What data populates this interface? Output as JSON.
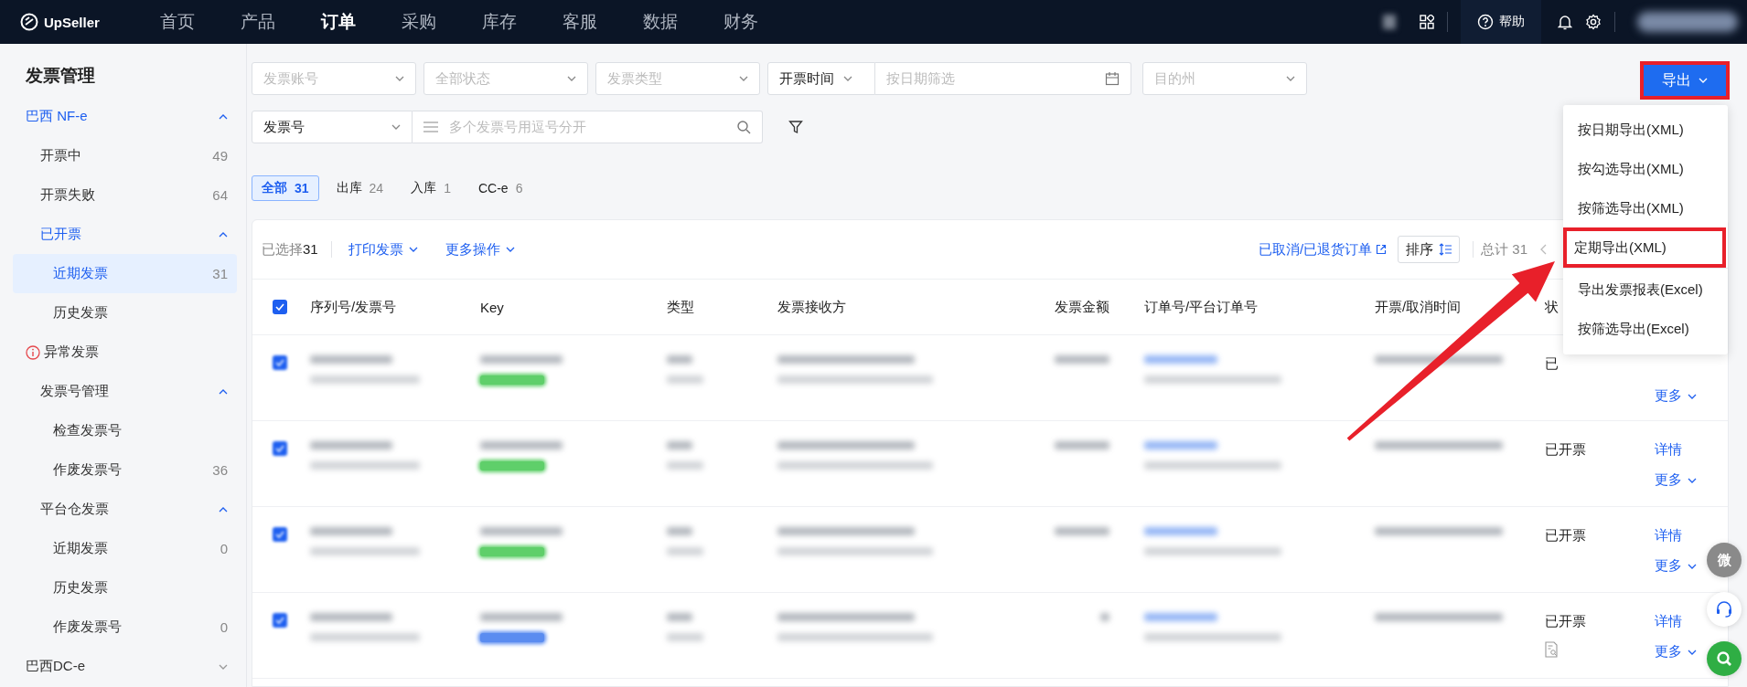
{
  "topbar": {
    "logo": "UpSeller",
    "nav": [
      {
        "label": "首页",
        "selected": false
      },
      {
        "label": "产品",
        "selected": false
      },
      {
        "label": "订单",
        "selected": true
      },
      {
        "label": "采购",
        "selected": false
      },
      {
        "label": "库存",
        "selected": false
      },
      {
        "label": "客服",
        "selected": false
      },
      {
        "label": "数据",
        "selected": false
      },
      {
        "label": "财务",
        "selected": false
      }
    ],
    "help": "帮助"
  },
  "sidebar": {
    "title": "发票管理",
    "items": [
      {
        "label": "巴西 NF-e",
        "expanded": true,
        "children": [
          {
            "label": "开票中",
            "count": "49"
          },
          {
            "label": "开票失败",
            "count": "64"
          },
          {
            "label": "已开票",
            "expanded": true,
            "children": [
              {
                "label": "近期发票",
                "count": "31",
                "selected": true
              },
              {
                "label": "历史发票",
                "selected": false
              }
            ]
          }
        ]
      },
      {
        "label": "异常发票",
        "alert": true,
        "children": [
          {
            "label": "发票号管理",
            "expanded": true,
            "children": [
              {
                "label": "检查发票号",
                "selected": false
              },
              {
                "label": "作废发票号",
                "count": "36",
                "selected": false
              }
            ]
          },
          {
            "label": "平台仓发票",
            "expanded": true,
            "children": [
              {
                "label": "近期发票",
                "count": "0",
                "selected": false
              },
              {
                "label": "历史发票",
                "selected": false
              },
              {
                "label": "作废发票号",
                "count": "0",
                "selected": false
              }
            ]
          }
        ]
      },
      {
        "label": "巴西DC-e",
        "expanded": false
      }
    ]
  },
  "filters": {
    "account": {
      "placeholder": "发票账号"
    },
    "status": {
      "placeholder": "全部状态"
    },
    "type": {
      "placeholder": "发票类型"
    },
    "time_mode": {
      "value": "开票时间"
    },
    "date": {
      "placeholder": "按日期筛选"
    },
    "state": {
      "placeholder": "目的州"
    },
    "search_field": {
      "value": "发票号"
    },
    "search": {
      "placeholder": "多个发票号用逗号分开"
    }
  },
  "tabs": [
    {
      "label": "全部",
      "count": "31",
      "selected": true
    },
    {
      "label": "出库",
      "count": "24",
      "selected": false
    },
    {
      "label": "入库",
      "count": "1",
      "selected": false
    },
    {
      "label": "CC-e",
      "count": "6",
      "selected": false
    }
  ],
  "export": {
    "label": "导出",
    "highlighted": true,
    "menu": [
      [
        {
          "label": "按日期导出(XML)",
          "highlighted": false
        },
        {
          "label": "按勾选导出(XML)",
          "highlighted": false
        },
        {
          "label": "按筛选导出(XML)",
          "highlighted": false
        },
        {
          "label": "定期导出(XML)",
          "highlighted": true
        }
      ],
      [
        {
          "label": "导出发票报表(Excel)",
          "highlighted": false
        },
        {
          "label": "按筛选导出(Excel)",
          "highlighted": false
        }
      ]
    ]
  },
  "toolbar": {
    "selected_label": "已选择",
    "selected_count": "31",
    "print": "打印发票",
    "more_actions": "更多操作",
    "cancelled_link": "已取消/已退货订单",
    "sort": "排序",
    "total": "总计 31"
  },
  "table": {
    "all_checked": true,
    "columns": [
      "序列号/发票号",
      "Key",
      "类型",
      "发票接收方",
      "发票金额",
      "订单号/平台订单号",
      "开票/取消时间",
      "状"
    ],
    "rows": [
      {
        "checked": true,
        "color": "#5fcf6a",
        "status": "已",
        "actions": [
          "更多"
        ]
      },
      {
        "checked": true,
        "color": "#5fcf6a",
        "status": "已开票",
        "actions": [
          "详情",
          "更多"
        ]
      },
      {
        "checked": true,
        "color": "#5fcf6a",
        "status": "已开票",
        "actions": [
          "详情",
          "更多"
        ]
      },
      {
        "checked": true,
        "color": "#5a8cf0",
        "status": "已开票",
        "doc_icon": true,
        "actions": [
          "详情",
          "更多"
        ]
      }
    ]
  },
  "float": {
    "wechat": "微"
  }
}
